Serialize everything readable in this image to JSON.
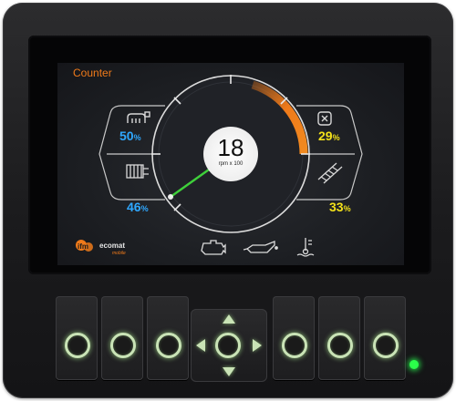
{
  "screen": {
    "title": "Counter",
    "gauge": {
      "value": "18",
      "unit": "rpm x 100"
    },
    "readouts": [
      {
        "id": "top-left",
        "value": "50",
        "unit": "%",
        "color": "#2fa8ff",
        "icon": "hydraulic-icon"
      },
      {
        "id": "bottom-left",
        "value": "46",
        "unit": "%",
        "color": "#2fa8ff",
        "icon": "radiator-icon"
      },
      {
        "id": "top-right",
        "value": "29",
        "unit": "%",
        "color": "#f3e11a",
        "icon": "bucket-icon"
      },
      {
        "id": "bottom-right",
        "value": "33",
        "unit": "%",
        "color": "#f3e11a",
        "icon": "ladder-icon"
      }
    ],
    "bottom_icons": [
      "engine-icon",
      "oil-can-icon",
      "coolant-temperature-icon"
    ],
    "logo": {
      "brand": "ifm",
      "product": "ecomat mobile"
    }
  },
  "colors": {
    "accent": "#ef7a1a",
    "needle": "#3fd03b",
    "button_ring": "#c9e3b6",
    "status_led": "#2bff4a"
  }
}
